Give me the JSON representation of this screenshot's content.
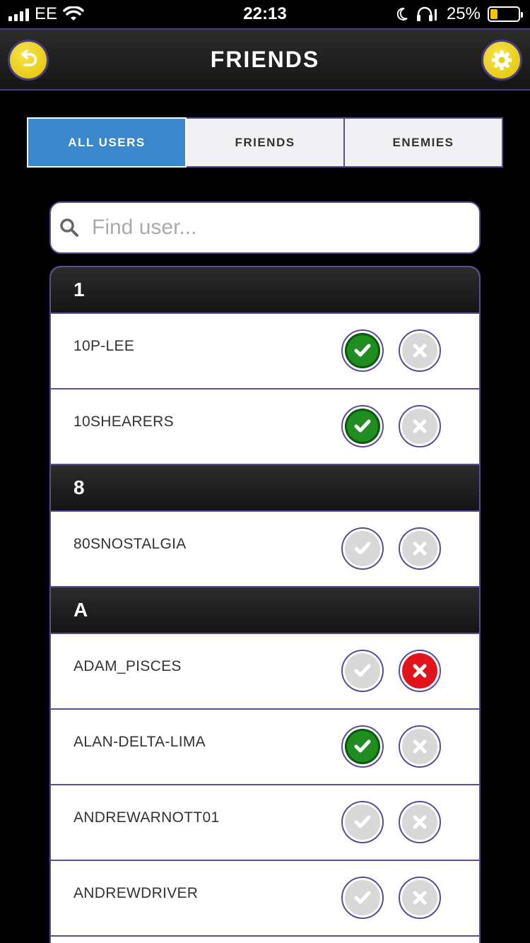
{
  "status_bar": {
    "carrier": "EE",
    "time": "22:13",
    "battery": "25%",
    "battery_level": 0.25
  },
  "header": {
    "title": "FRIENDS",
    "back_icon": "undo-arrow-icon",
    "settings_icon": "gear-icon",
    "accent_color": "#e8cc12"
  },
  "tabs": [
    {
      "label": "ALL USERS",
      "active": true
    },
    {
      "label": "FRIENDS",
      "active": false
    },
    {
      "label": "ENEMIES",
      "active": false
    }
  ],
  "search": {
    "placeholder": "Find user..."
  },
  "sections": [
    {
      "header": "1",
      "users": [
        {
          "name": "10P-LEE",
          "friend": true,
          "enemy": false
        },
        {
          "name": "10SHEARERS",
          "friend": true,
          "enemy": false
        }
      ]
    },
    {
      "header": "8",
      "users": [
        {
          "name": "80SNOSTALGIA",
          "friend": false,
          "enemy": false
        }
      ]
    },
    {
      "header": "A",
      "users": [
        {
          "name": "ADAM_PISCES",
          "friend": false,
          "enemy": true
        },
        {
          "name": "ALAN-DELTA-LIMA",
          "friend": true,
          "enemy": false
        },
        {
          "name": "ANDREWARNOTT01",
          "friend": false,
          "enemy": false
        },
        {
          "name": "ANDREWDRIVER",
          "friend": false,
          "enemy": false
        }
      ]
    }
  ],
  "colors": {
    "friend_on": "#1f8d1f",
    "enemy_on": "#e2131b",
    "off": "#d8d8d8",
    "active_tab": "#3a87cc",
    "border": "#5d4a9a"
  }
}
